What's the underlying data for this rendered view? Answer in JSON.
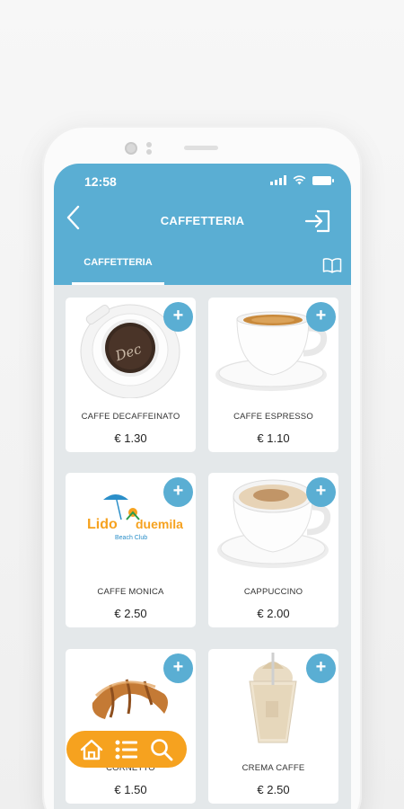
{
  "status_bar": {
    "time": "12:58"
  },
  "header": {
    "title": "CAFFETTERIA"
  },
  "tabs": [
    {
      "label": "CAFFETTERIA",
      "active": true
    }
  ],
  "products": [
    {
      "name": "CAFFE DECAFFEINATO",
      "price": "€ 1.30",
      "image": "decaf-coffee-cup",
      "add_label": "+"
    },
    {
      "name": "CAFFE ESPRESSO",
      "price": "€ 1.10",
      "image": "espresso-cup",
      "add_label": "+"
    },
    {
      "name": "CAFFE MONICA",
      "price": "€ 2.50",
      "image": "lido-duemila-logo",
      "add_label": "+",
      "logo_text": {
        "word1": "Lido",
        "word2": "duemila",
        "tagline": "Beach Club"
      }
    },
    {
      "name": "CAPPUCCINO",
      "price": "€ 2.00",
      "image": "cappuccino-cup",
      "add_label": "+"
    },
    {
      "name": "CORNETTO",
      "price": "€ 1.50",
      "image": "croissant",
      "add_label": "+"
    },
    {
      "name": "CREMA CAFFE",
      "price": "€ 2.50",
      "image": "crema-caffe-glass",
      "add_label": "+"
    }
  ],
  "bottom_nav": [
    {
      "icon": "home-icon"
    },
    {
      "icon": "list-icon"
    },
    {
      "icon": "search-icon"
    }
  ],
  "colors": {
    "primary": "#5aaed3",
    "accent": "#f6a21f",
    "background": "#e4e8ea"
  }
}
